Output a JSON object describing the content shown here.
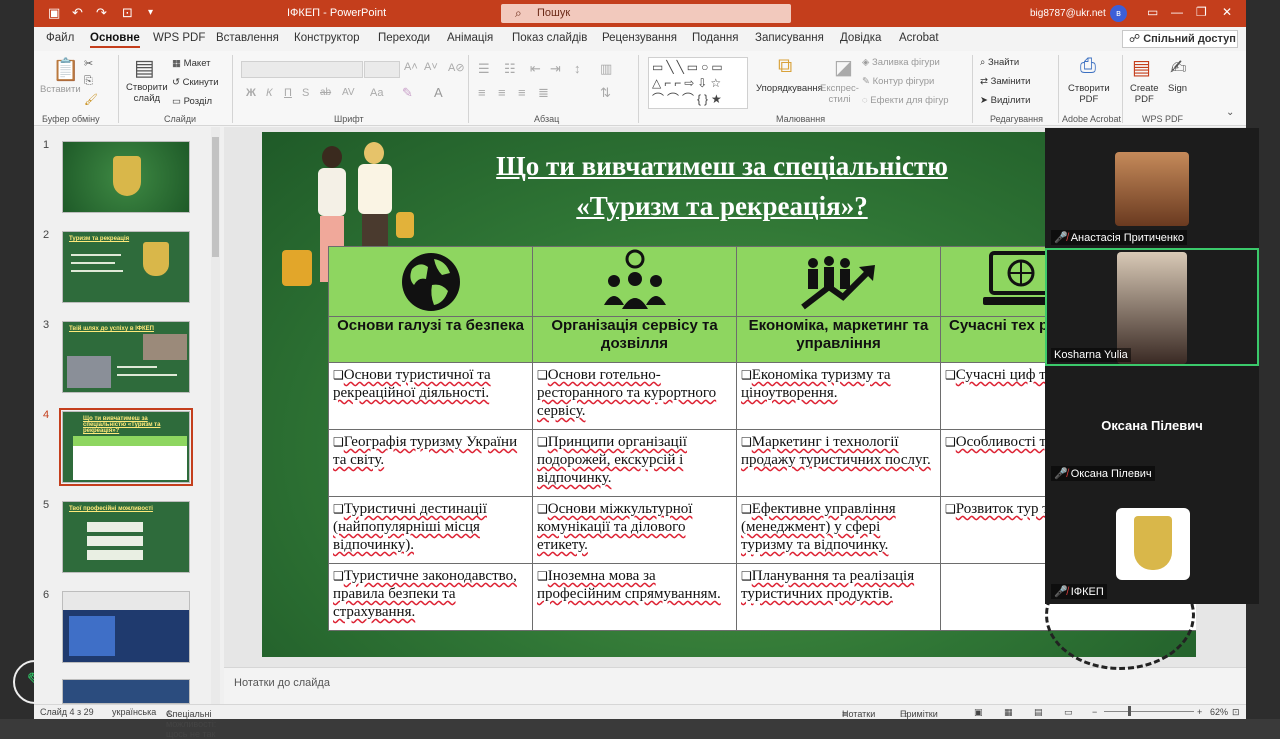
{
  "titlebar": {
    "doc_title": "ІФКЕП",
    "separator": "-",
    "app_name": "PowerPoint",
    "search_placeholder": "Пошук",
    "email": "big8787@ukr.net",
    "avatar_letter": "в"
  },
  "menu": {
    "tabs": [
      "Файл",
      "Основне",
      "WPS PDF",
      "Вставлення",
      "Конструктор",
      "Переходи",
      "Анімація",
      "Показ слайдів",
      "Рецензування",
      "Подання",
      "Записування",
      "Довідка",
      "Acrobat"
    ],
    "active_tab": "Основне",
    "share_label": "Спільний доступ"
  },
  "ribbon": {
    "paste": "Вставити",
    "new_slide_1": "Створити",
    "new_slide_2": "слайд",
    "layout": "Макет",
    "reset": "Скинути",
    "sections": "Розділ",
    "arrange": "Упорядкування",
    "quick_styles_1": "Експрес-",
    "quick_styles_2": "стилі",
    "shape_fill": "Заливка фігури",
    "shape_outline": "Контур фігури",
    "shape_effects": "Ефекти для фігур",
    "find": "Знайти",
    "replace": "Замінити",
    "select": "Виділити",
    "create_pdf_1": "Створити",
    "create_pdf_2": "PDF",
    "create_pdf_en_1": "Create",
    "create_pdf_en_2": "PDF",
    "sign": "Sign",
    "groups": {
      "clipboard": "Буфер обміну",
      "slides": "Слайди",
      "font": "Шрифт",
      "paragraph": "Абзац",
      "drawing": "Малювання",
      "editing": "Редагування",
      "acrobat": "Adobe Acrobat",
      "wps": "WPS PDF"
    },
    "font_buttons": [
      "Ж",
      "К",
      "П",
      "S",
      "ab",
      "AV",
      "Aa"
    ]
  },
  "thumbnails": {
    "numbers": [
      "1",
      "2",
      "3",
      "4",
      "5",
      "6"
    ],
    "active_index": 4,
    "titles": [
      "",
      "Туризм та рекреація",
      "Твій шлях до успіху в ІФКЕП",
      "Що ти вивчатимеш за спеціальністю «Туризм та рекреація»?",
      "Твої професійні можливості",
      ""
    ]
  },
  "slide": {
    "title_line1": "Що ти вивчатимеш за спеціальністю",
    "title_line2": "«Туризм та рекреація»?",
    "columns": [
      {
        "header": "Основи галузі та безпека",
        "icon": "globe-icon",
        "items": [
          "Основи туристичної та рекреаційної діяльності.",
          "Географія туризму України та світу.",
          "Туристичні дестинації (найпопулярніші місця відпочинку).",
          "Туристичне законодавство, правила безпеки та страхування."
        ]
      },
      {
        "header": "Організація сервісу та дозвілля",
        "icon": "team-idea-icon",
        "items": [
          "Основи готельно-ресторанного та курортного сервісу.",
          "Принципи організації подорожей, екскурсій і відпочинку.",
          "Основи міжкультурної комунікації та ділового етикету.",
          "Іноземна мова за професійним спрямуванням."
        ]
      },
      {
        "header": "Економіка, маркетинг та управління",
        "icon": "growth-chart-icon",
        "items": [
          "Економіка туризму та ціноутворення.",
          "Маркетинг і технології продажу туристичних послуг.",
          "Ефективне управління (менеджмент) у сфері туризму та відпочинку.",
          "Планування та реалізація туристичних продуктів."
        ]
      },
      {
        "header": "Сучасні тех розві",
        "icon": "laptop-globe-icon",
        "items": [
          "Сучасні циф технології в",
          "Особливості туризму (еко підхід).",
          "Розвиток тур територій та",
          ""
        ]
      }
    ]
  },
  "notes_placeholder": "Нотатки до слайда",
  "status": {
    "slide_counter": "Слайд 4 з 29",
    "language": "українська",
    "accessibility": "Спеціальні можливості: щось не так",
    "notes_btn": "Нотатки",
    "comments_btn": "Примітки",
    "zoom": "62%"
  },
  "video": {
    "participants": [
      {
        "name": "Анастасія Притиченко",
        "muted": true
      },
      {
        "name": "Kosharna Yulia",
        "muted": false
      },
      {
        "name": "Оксана Пілевич",
        "muted": true,
        "display": "Оксана Пілевич"
      },
      {
        "name": "ІФКЕП",
        "muted": true
      }
    ]
  },
  "colors": {
    "accent": "#c43e1c",
    "slide_green": "#2f7535",
    "header_green": "#8ed660",
    "active_speaker": "#3bc96b"
  }
}
